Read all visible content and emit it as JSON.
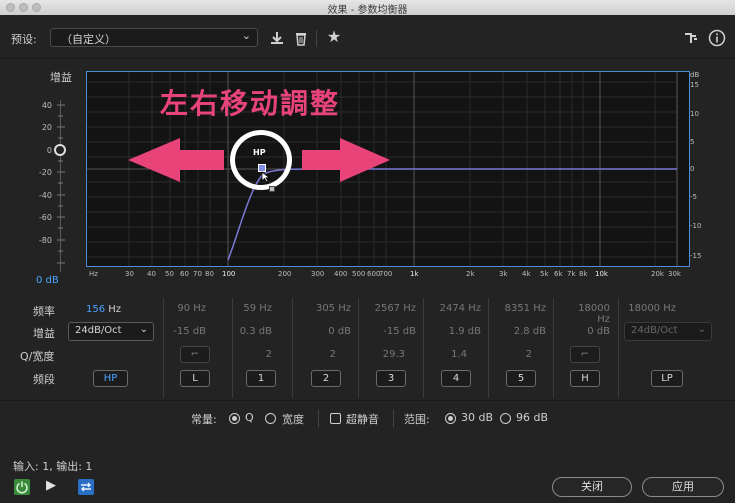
{
  "window": {
    "title": "效果 - 参数均衡器"
  },
  "toolbar": {
    "preset_label": "预设:",
    "preset_value": "（自定义）"
  },
  "gain_slider": {
    "label": "增益",
    "ticks": [
      "40",
      "20",
      "0",
      "-20",
      "-40",
      "-60",
      "-80"
    ],
    "value": "0 dB"
  },
  "graph": {
    "overlay_text": "左右移动調整",
    "db_unit": "dB",
    "db_ticks": [
      "15",
      "10",
      "5",
      "0",
      "-5",
      "-10",
      "-15"
    ],
    "freq_ticks": [
      "Hz",
      "30",
      "40",
      "50",
      "60",
      "70",
      "80",
      "100",
      "200",
      "300",
      "400",
      "500",
      "600",
      "700",
      "1k",
      "2k",
      "3k",
      "4k",
      "5k",
      "6k",
      "7k",
      "8k",
      "10k",
      "20k",
      "30k"
    ],
    "hp_node_label": "HP"
  },
  "bands": {
    "row_labels": {
      "freq": "频率",
      "gain": "增益",
      "q": "Q/宽度",
      "band": "频段"
    },
    "hp": {
      "freq_value": "156",
      "freq_unit": "Hz",
      "slope": "24dB/Oct",
      "button": "HP"
    },
    "columns": [
      {
        "freq": "90 Hz",
        "gain": "-15 dB",
        "q": "",
        "button": "L"
      },
      {
        "freq": "59 Hz",
        "gain": "0.3 dB",
        "q": "2",
        "button": "1"
      },
      {
        "freq": "305 Hz",
        "gain": "0 dB",
        "q": "2",
        "button": "2"
      },
      {
        "freq": "2567 Hz",
        "gain": "-15 dB",
        "q": "29.3",
        "button": "3"
      },
      {
        "freq": "2474 Hz",
        "gain": "1.9 dB",
        "q": "1.4",
        "button": "4"
      },
      {
        "freq": "8351 Hz",
        "gain": "2.8 dB",
        "q": "2",
        "button": "5"
      },
      {
        "freq": "18000 Hz",
        "gain": "0 dB",
        "q": "",
        "button": "H"
      }
    ],
    "lp": {
      "freq": "18000 Hz",
      "slope": "24dB/Oct",
      "button": "LP"
    }
  },
  "options": {
    "constant_label": "常量:",
    "q_label": "Q",
    "width_label": "宽度",
    "ultra_quiet_label": "超静音",
    "range_label": "范围:",
    "range_30": "30 dB",
    "range_96": "96 dB"
  },
  "footer": {
    "io_text": "输入: 1, 输出: 1",
    "close_label": "关闭",
    "apply_label": "应用"
  },
  "colors": {
    "accent": "#4aa3ff",
    "overlay_pink": "#e8447a",
    "curve": "#7b79d6",
    "graph_border": "#4a8ed8"
  }
}
